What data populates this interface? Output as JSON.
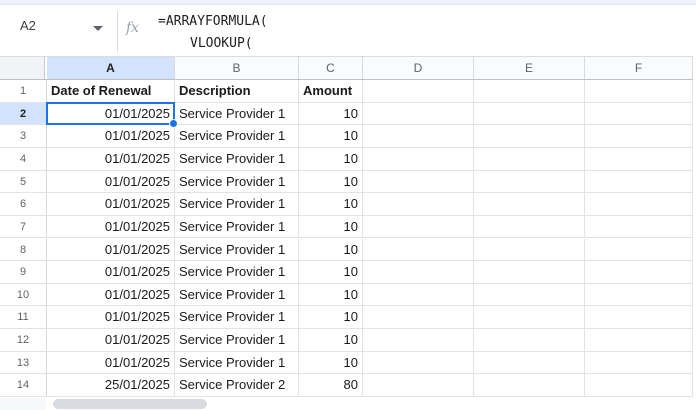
{
  "name_box": {
    "value": "A2"
  },
  "formula_bar": {
    "fx": "fx",
    "lines": [
      "=ARRAYFORMULA(",
      "VLOOKUP("
    ]
  },
  "grid": {
    "column_headers": [
      "A",
      "B",
      "C",
      "D",
      "E",
      "F"
    ],
    "selected": {
      "cell": "A2",
      "column_index": 0,
      "row_number": "2"
    },
    "rows": [
      {
        "n": "1",
        "bold": true,
        "cells": [
          "Date of Renewal",
          "Description",
          "Amount",
          "",
          "",
          ""
        ]
      },
      {
        "n": "2",
        "bold": false,
        "cells": [
          "01/01/2025",
          "Service Provider 1",
          "10",
          "",
          "",
          ""
        ]
      },
      {
        "n": "3",
        "bold": false,
        "cells": [
          "01/01/2025",
          "Service Provider 1",
          "10",
          "",
          "",
          ""
        ]
      },
      {
        "n": "4",
        "bold": false,
        "cells": [
          "01/01/2025",
          "Service Provider 1",
          "10",
          "",
          "",
          ""
        ]
      },
      {
        "n": "5",
        "bold": false,
        "cells": [
          "01/01/2025",
          "Service Provider 1",
          "10",
          "",
          "",
          ""
        ]
      },
      {
        "n": "6",
        "bold": false,
        "cells": [
          "01/01/2025",
          "Service Provider 1",
          "10",
          "",
          "",
          ""
        ]
      },
      {
        "n": "7",
        "bold": false,
        "cells": [
          "01/01/2025",
          "Service Provider 1",
          "10",
          "",
          "",
          ""
        ]
      },
      {
        "n": "8",
        "bold": false,
        "cells": [
          "01/01/2025",
          "Service Provider 1",
          "10",
          "",
          "",
          ""
        ]
      },
      {
        "n": "9",
        "bold": false,
        "cells": [
          "01/01/2025",
          "Service Provider 1",
          "10",
          "",
          "",
          ""
        ]
      },
      {
        "n": "10",
        "bold": false,
        "cells": [
          "01/01/2025",
          "Service Provider 1",
          "10",
          "",
          "",
          ""
        ]
      },
      {
        "n": "11",
        "bold": false,
        "cells": [
          "01/01/2025",
          "Service Provider 1",
          "10",
          "",
          "",
          ""
        ]
      },
      {
        "n": "12",
        "bold": false,
        "cells": [
          "01/01/2025",
          "Service Provider 1",
          "10",
          "",
          "",
          ""
        ]
      },
      {
        "n": "13",
        "bold": false,
        "cells": [
          "01/01/2025",
          "Service Provider 1",
          "10",
          "",
          "",
          ""
        ]
      },
      {
        "n": "14",
        "bold": false,
        "cells": [
          "25/01/2025",
          "Service Provider 2",
          "80",
          "",
          "",
          ""
        ]
      }
    ]
  },
  "colors": {
    "selection_blue": "#1a73e8",
    "selected_header_bg": "#d3e3fd"
  }
}
